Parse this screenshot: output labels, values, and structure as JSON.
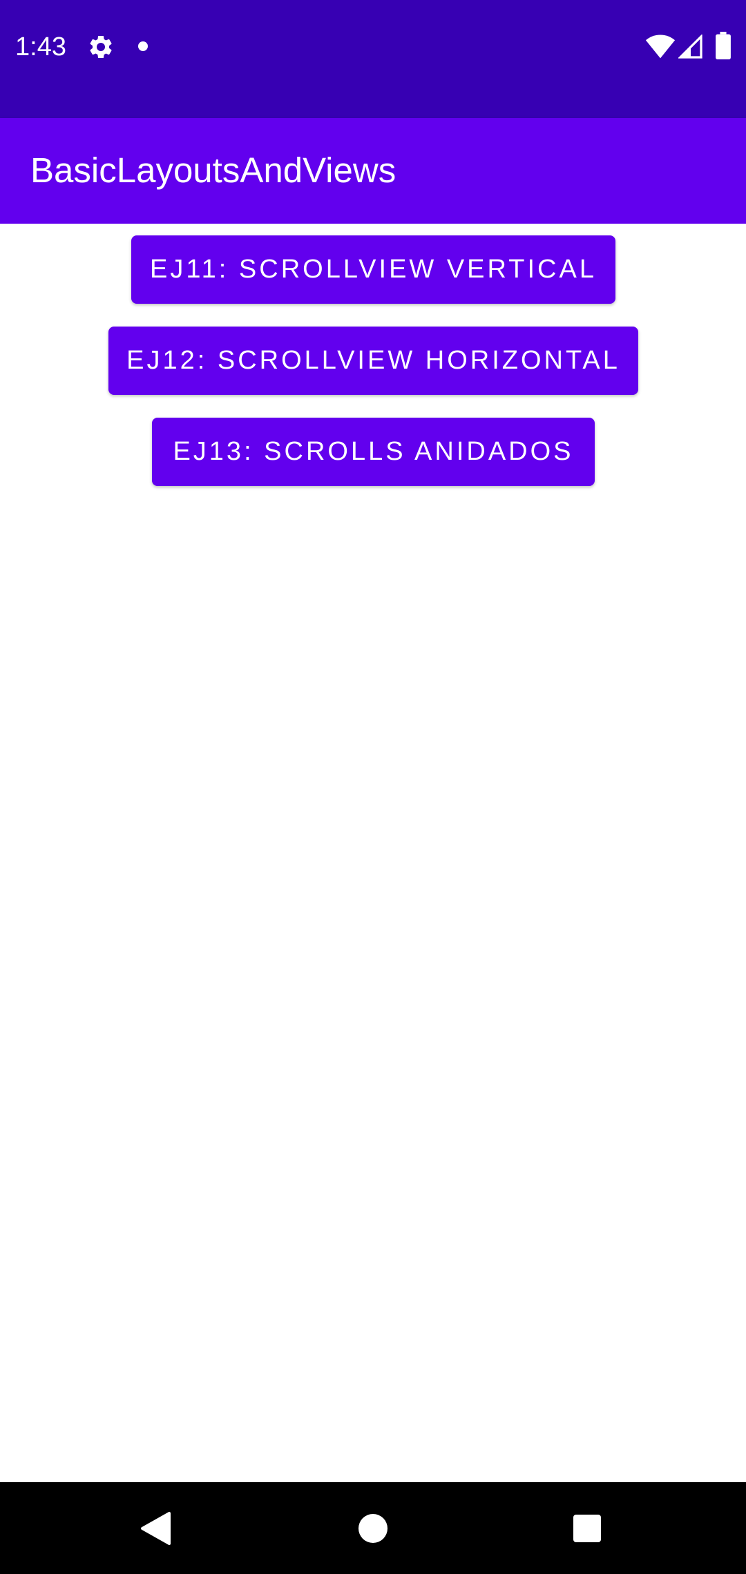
{
  "status_bar": {
    "time": "1:43",
    "icons": [
      "settings-gear-icon",
      "notification-dot-icon",
      "wifi-icon",
      "cell-signal-icon",
      "battery-icon"
    ],
    "background_color": "#3700b3"
  },
  "app_bar": {
    "title": "BasicLayoutsAndViews",
    "background_color": "#6200ee"
  },
  "buttons": [
    {
      "label": "EJ11: SCROLLVIEW VERTICAL"
    },
    {
      "label": "EJ12: SCROLLVIEW HORIZONTAL"
    },
    {
      "label": "EJ13: SCROLLS ANIDADOS"
    }
  ],
  "button_color": "#6200ee",
  "nav_bar": {
    "icons": [
      "back-icon",
      "home-icon",
      "recents-icon"
    ]
  }
}
